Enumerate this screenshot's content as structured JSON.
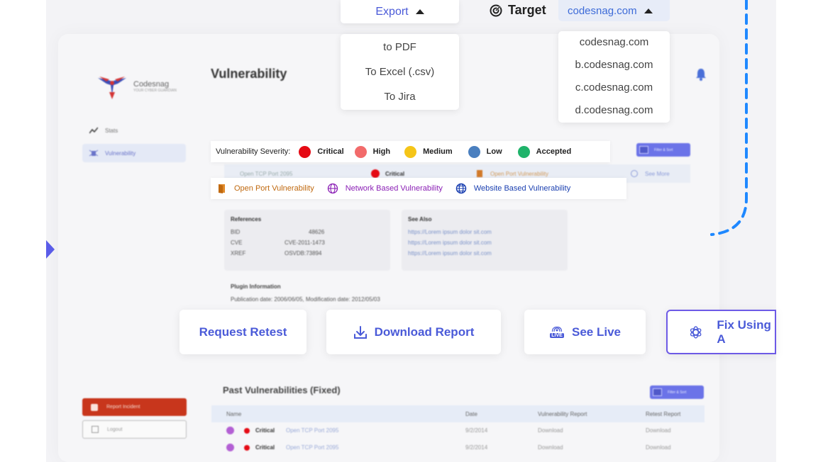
{
  "app": {
    "name": "Codesnag",
    "tagline": "YOUR CYBER GUARDIAN",
    "page_title": "Vulnerability"
  },
  "sidebar": {
    "items": [
      {
        "label": "Stats",
        "icon": "stats-icon",
        "active": false
      },
      {
        "label": "Vulnerability",
        "icon": "bug-icon",
        "active": true
      }
    ],
    "report_label": "Report Incident",
    "logout_label": "Logout"
  },
  "export": {
    "label": "Export",
    "options": [
      "to PDF",
      "To Excel (.csv)",
      "To Jira"
    ]
  },
  "target": {
    "label": "Target",
    "selected": "codesnag.com",
    "options": [
      "codesnag.com",
      "b.codesnag.com",
      "c.codesnag.com",
      "d.codesnag.com"
    ]
  },
  "severity": {
    "label": "Vulnerability Severity:",
    "levels": [
      {
        "label": "Critical",
        "color": "#e50a14"
      },
      {
        "label": "High",
        "color": "#f26b6b"
      },
      {
        "label": "Medium",
        "color": "#f5c518"
      },
      {
        "label": "Low",
        "color": "#4a7fbf"
      },
      {
        "label": "Accepted",
        "color": "#1fb36a"
      }
    ]
  },
  "filter": {
    "label": "Filter & Sort"
  },
  "vuln_row": {
    "name": "Open TCP Port 2095",
    "severity": "Critical",
    "type": "Open Port Vulnerability",
    "more": "See More"
  },
  "vuln_types": [
    {
      "label": "Open Port Vulnerability",
      "color": "#c0690f",
      "icon": "door-icon"
    },
    {
      "label": "Network Based Vulnerability",
      "color": "#8a1fb5",
      "icon": "network-icon"
    },
    {
      "label": "Website Based Vulnerability",
      "color": "#1a3fb0",
      "icon": "globe-icon"
    }
  ],
  "references": {
    "title": "References",
    "rows": [
      {
        "key": "BID",
        "value": "48626"
      },
      {
        "key": "CVE",
        "value": "CVE-2011-1473"
      },
      {
        "key": "XREF",
        "value": "OSVDB:73894"
      }
    ]
  },
  "see_also": {
    "title": "See Also",
    "links": [
      "https://Lorem ipsum dolor sit.com",
      "https://Lorem ipsum dolor sit.com",
      "https://Lorem ipsum dolor sit.com"
    ]
  },
  "plugin": {
    "title": "Plugin Information",
    "dates": "Publication date: 2006/06/05, Modification date: 2012/05/03"
  },
  "actions": {
    "retest": "Request Retest",
    "download": "Download Report",
    "live": "See Live",
    "live_badge": "LIVE",
    "ai": "Fix Using A"
  },
  "past": {
    "title": "Past Vulnerabilities (Fixed)",
    "columns": [
      "Name",
      "Date",
      "Vulnerability Report",
      "Retest Report"
    ],
    "rows": [
      {
        "severity": "Critical",
        "name": "Open TCP Port 2095",
        "date": "9/2/2014",
        "vuln_report": "Download",
        "retest_report": "Download"
      },
      {
        "severity": "Critical",
        "name": "Open TCP Port 2095",
        "date": "9/2/2014",
        "vuln_report": "Download",
        "retest_report": "Download"
      }
    ]
  },
  "colors": {
    "accent": "#4a5ad8",
    "link": "#3d6bd8",
    "decor_dashed": "#1e88ff"
  }
}
